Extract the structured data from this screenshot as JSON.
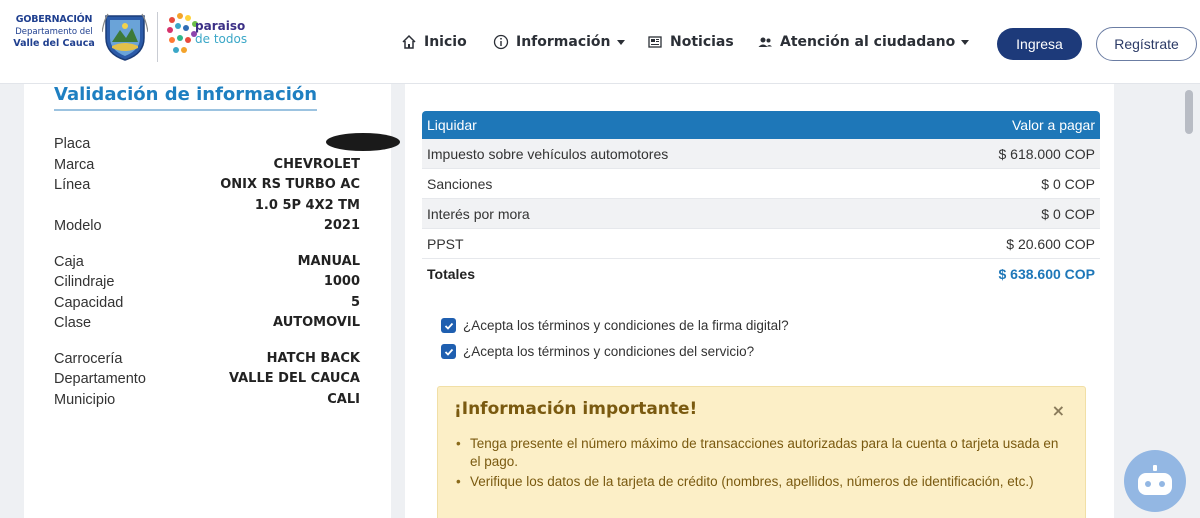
{
  "header": {
    "logo": {
      "line1": "GOBERNACIÓN",
      "line2": "Departamento del",
      "line3": "Valle del Cauca"
    },
    "slogan": {
      "line1": "paraiso",
      "line2": "de todos"
    },
    "nav": [
      {
        "label": "Inicio",
        "icon": "home-icon"
      },
      {
        "label": "Información",
        "icon": "info-icon"
      },
      {
        "label": "Noticias",
        "icon": "newspaper-icon"
      },
      {
        "label": "Atención al ciudadano",
        "icon": "users-icon"
      }
    ],
    "login_label": "Ingresa",
    "register_label": "Regístrate",
    "colors": {
      "navy": "#1d3a7a",
      "blue": "#1e77b8"
    }
  },
  "vehicle": {
    "title": "Validación de información",
    "fields": [
      {
        "label": "Placa",
        "value": ""
      },
      {
        "label": "Marca",
        "value": "CHEVROLET"
      },
      {
        "label": "Línea",
        "value": "ONIX RS TURBO AC"
      },
      {
        "label": "",
        "value": "1.0 5P 4X2 TM"
      },
      {
        "label": "Modelo",
        "value": "2021"
      },
      {
        "label": "Caja",
        "value": "MANUAL"
      },
      {
        "label": "Cilindraje",
        "value": "1000"
      },
      {
        "label": "Capacidad",
        "value": "5"
      },
      {
        "label": "Clase",
        "value": "AUTOMOVIL"
      },
      {
        "label": "Carrocería",
        "value": "HATCH BACK"
      },
      {
        "label": "Departamento",
        "value": "VALLE DEL CAUCA"
      },
      {
        "label": "Municipio",
        "value": "CALI"
      }
    ]
  },
  "payment": {
    "header": {
      "left": "Liquidar",
      "right": "Valor a pagar"
    },
    "rows": [
      {
        "label": "Impuesto sobre vehículos automotores",
        "amount": "$ 618.000 COP"
      },
      {
        "label": "Sanciones",
        "amount": "$ 0 COP"
      },
      {
        "label": "Interés por mora",
        "amount": "$ 0 COP"
      },
      {
        "label": "PPST",
        "amount": "$ 20.600 COP"
      }
    ],
    "total": {
      "label": "Totales",
      "amount": "$ 638.600 COP"
    }
  },
  "terms": {
    "digital_signature": "¿Acepta los términos y condiciones de la firma digital?",
    "service": "¿Acepta los términos y condiciones del servicio?"
  },
  "alert": {
    "title": "¡Información importante!",
    "close": "×",
    "items": [
      "Tenga presente el número máximo de transacciones autorizadas para la cuenta o tarjeta usada en el pago.",
      "Verifique los datos de la tarjeta de crédito (nombres, apellidos, números de identificación, etc.)"
    ]
  }
}
